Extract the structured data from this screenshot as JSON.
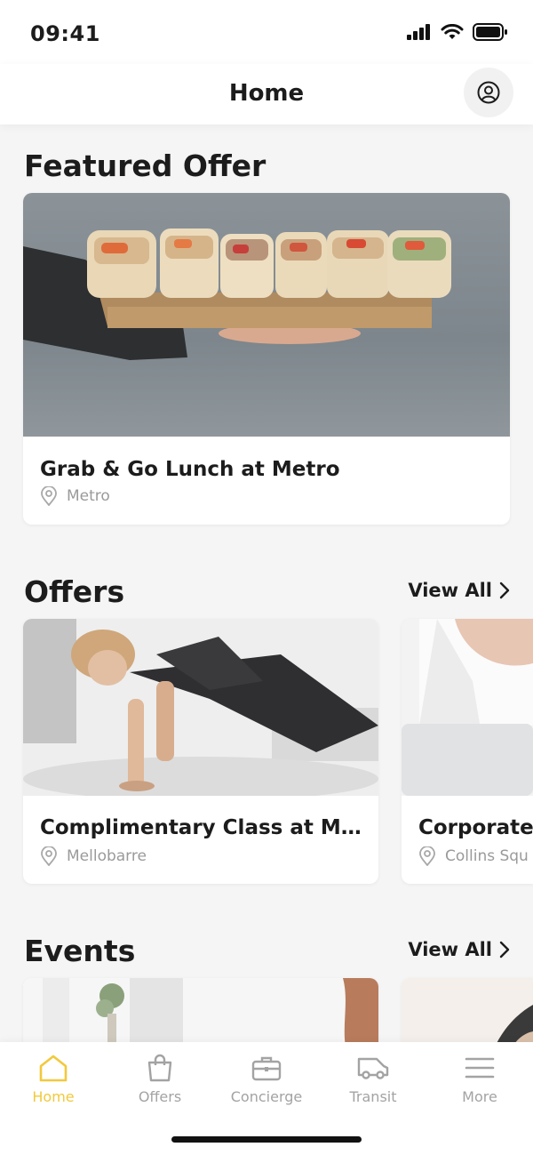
{
  "status": {
    "time": "09:41"
  },
  "header": {
    "title": "Home"
  },
  "featured": {
    "section_title": "Featured Offer",
    "card": {
      "title": "Grab & Go Lunch at Metro",
      "location": "Metro"
    }
  },
  "offers": {
    "section_title": "Offers",
    "view_all": "View All",
    "cards": [
      {
        "title": "Complimentary Class at Mel...",
        "location": "Mellobarre"
      },
      {
        "title": "Corporate V",
        "location": "Collins Squ"
      }
    ]
  },
  "events": {
    "section_title": "Events",
    "view_all": "View All"
  },
  "tabbar": {
    "accent_color": "#f2c93b",
    "inactive_color": "#a3a3a3",
    "items": [
      {
        "label": "Home",
        "icon": "home-icon"
      },
      {
        "label": "Offers",
        "icon": "shopping-bag-icon"
      },
      {
        "label": "Concierge",
        "icon": "briefcase-icon"
      },
      {
        "label": "Transit",
        "icon": "van-icon"
      },
      {
        "label": "More",
        "icon": "menu-icon"
      }
    ]
  }
}
